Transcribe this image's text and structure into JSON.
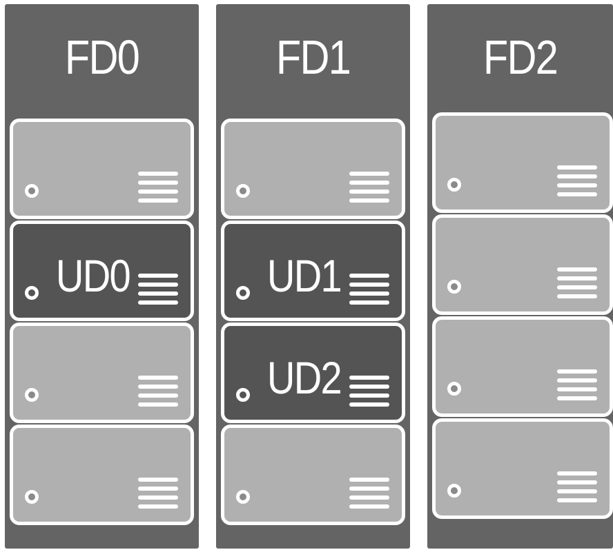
{
  "fault_domains": [
    {
      "label": "FD0",
      "disks": [
        {
          "role": "disk",
          "label": ""
        },
        {
          "role": "ud",
          "label": "UD0"
        },
        {
          "role": "disk",
          "label": ""
        },
        {
          "role": "disk",
          "label": ""
        }
      ]
    },
    {
      "label": "FD1",
      "disks": [
        {
          "role": "disk",
          "label": ""
        },
        {
          "role": "ud",
          "label": "UD1"
        },
        {
          "role": "ud",
          "label": "UD2"
        },
        {
          "role": "disk",
          "label": ""
        }
      ]
    },
    {
      "label": "FD2",
      "disks": [
        {
          "role": "disk",
          "label": ""
        },
        {
          "role": "disk",
          "label": ""
        },
        {
          "role": "disk",
          "label": ""
        },
        {
          "role": "disk",
          "label": ""
        }
      ]
    }
  ],
  "icons": {
    "led": "status-led-icon",
    "vent": "vent-lines-icon"
  },
  "colors": {
    "panel": "#646464",
    "disk": "#b0b0b0",
    "update_domain": "#545454",
    "outline": "#ffffff"
  }
}
